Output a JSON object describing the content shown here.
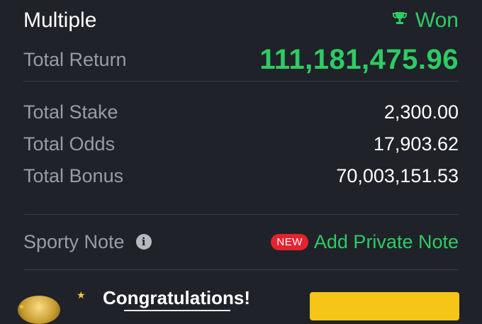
{
  "bet": {
    "type_label": "Multiple",
    "status": "Won",
    "total_return_label": "Total Return",
    "total_return": "111,181,475.96",
    "total_stake_label": "Total Stake",
    "total_stake": "2,300.00",
    "total_odds_label": "Total Odds",
    "total_odds": "17,903.62",
    "total_bonus_label": "Total Bonus",
    "total_bonus": "70,003,151.53"
  },
  "note": {
    "label": "Sporty Note",
    "badge": "NEW",
    "action": "Add Private Note"
  },
  "promo": {
    "title": "Congratulations!"
  },
  "colors": {
    "background": "#1f2229",
    "accent_green": "#2fcb63",
    "badge_red": "#e5222f",
    "cta_yellow": "#f5c518"
  },
  "icons": [
    "trophy-icon",
    "info-icon",
    "star-icon",
    "coin-icon"
  ]
}
